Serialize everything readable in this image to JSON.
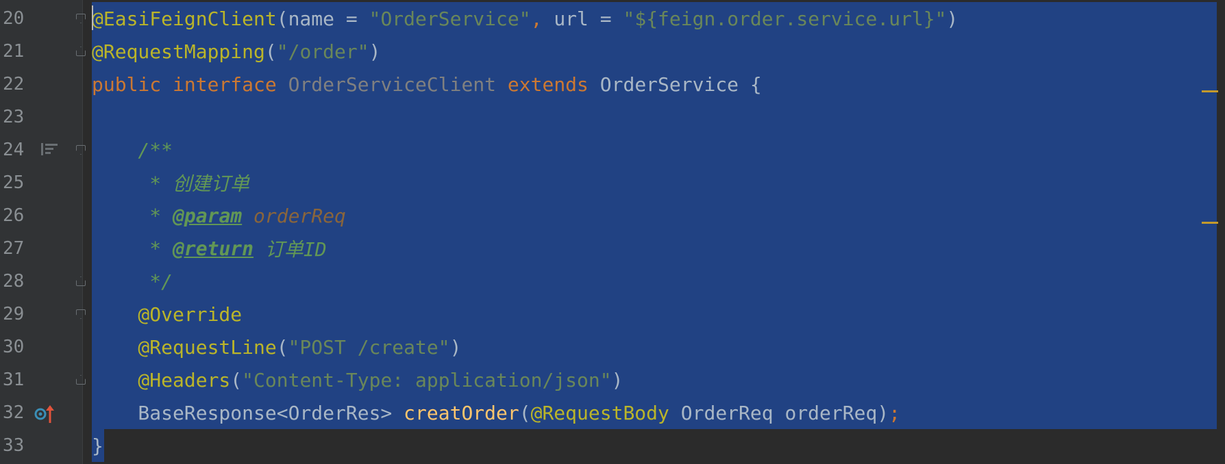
{
  "editor": {
    "selection_color": "#214283",
    "lines": [
      {
        "no": "20",
        "tokens": [
          {
            "t": "@EasiFeignClient",
            "c": "tok-ann"
          },
          {
            "t": "(",
            "c": "tok-plain"
          },
          {
            "t": "name = ",
            "c": "tok-plain"
          },
          {
            "t": "\"OrderService\"",
            "c": "tok-str"
          },
          {
            "t": ", ",
            "c": "tok-kw"
          },
          {
            "t": "url = ",
            "c": "tok-plain"
          },
          {
            "t": "\"${feign.order.service.url}\"",
            "c": "tok-str"
          },
          {
            "t": ")",
            "c": "tok-plain"
          }
        ]
      },
      {
        "no": "21",
        "tokens": [
          {
            "t": "@RequestMapping",
            "c": "tok-ann"
          },
          {
            "t": "(",
            "c": "tok-plain"
          },
          {
            "t": "\"/order\"",
            "c": "tok-str"
          },
          {
            "t": ")",
            "c": "tok-plain"
          }
        ]
      },
      {
        "no": "22",
        "tokens": [
          {
            "t": "public ",
            "c": "tok-kw"
          },
          {
            "t": "interface ",
            "c": "tok-kw"
          },
          {
            "t": "OrderServiceClient ",
            "c": "tok-gray"
          },
          {
            "t": "extends ",
            "c": "tok-kw"
          },
          {
            "t": "OrderService {",
            "c": "tok-plain"
          }
        ]
      },
      {
        "no": "23",
        "tokens": []
      },
      {
        "no": "24",
        "tokens": [
          {
            "t": "    /**",
            "c": "tok-com"
          }
        ]
      },
      {
        "no": "25",
        "tokens": [
          {
            "t": "     * 创建订单",
            "c": "tok-com"
          }
        ]
      },
      {
        "no": "26",
        "tokens": [
          {
            "t": "     * ",
            "c": "tok-com"
          },
          {
            "t": "@param",
            "c": "tok-tag"
          },
          {
            "t": " ",
            "c": "tok-com"
          },
          {
            "t": "orderReq",
            "c": "tok-param"
          }
        ]
      },
      {
        "no": "27",
        "tokens": [
          {
            "t": "     * ",
            "c": "tok-com"
          },
          {
            "t": "@return",
            "c": "tok-tag"
          },
          {
            "t": " 订单ID",
            "c": "tok-com"
          }
        ]
      },
      {
        "no": "28",
        "tokens": [
          {
            "t": "     */",
            "c": "tok-com"
          }
        ]
      },
      {
        "no": "29",
        "tokens": [
          {
            "t": "    @Override",
            "c": "tok-ann"
          }
        ]
      },
      {
        "no": "30",
        "tokens": [
          {
            "t": "    @RequestLine",
            "c": "tok-ann"
          },
          {
            "t": "(",
            "c": "tok-plain"
          },
          {
            "t": "\"POST /create\"",
            "c": "tok-str"
          },
          {
            "t": ")",
            "c": "tok-plain"
          }
        ]
      },
      {
        "no": "31",
        "tokens": [
          {
            "t": "    @Headers",
            "c": "tok-ann"
          },
          {
            "t": "(",
            "c": "tok-plain"
          },
          {
            "t": "\"Content-Type: application/json\"",
            "c": "tok-str"
          },
          {
            "t": ")",
            "c": "tok-plain"
          }
        ]
      },
      {
        "no": "32",
        "tokens": [
          {
            "t": "    BaseResponse<OrderRes> ",
            "c": "tok-plain"
          },
          {
            "t": "creatOrder",
            "c": "tok-fn"
          },
          {
            "t": "(",
            "c": "tok-plain"
          },
          {
            "t": "@RequestBody ",
            "c": "tok-ann"
          },
          {
            "t": "OrderReq orderReq)",
            "c": "tok-plain"
          },
          {
            "t": ";",
            "c": "tok-semi"
          }
        ]
      },
      {
        "no": "33",
        "tokens": [
          {
            "t": "}",
            "c": "tok-plain"
          }
        ]
      }
    ]
  }
}
